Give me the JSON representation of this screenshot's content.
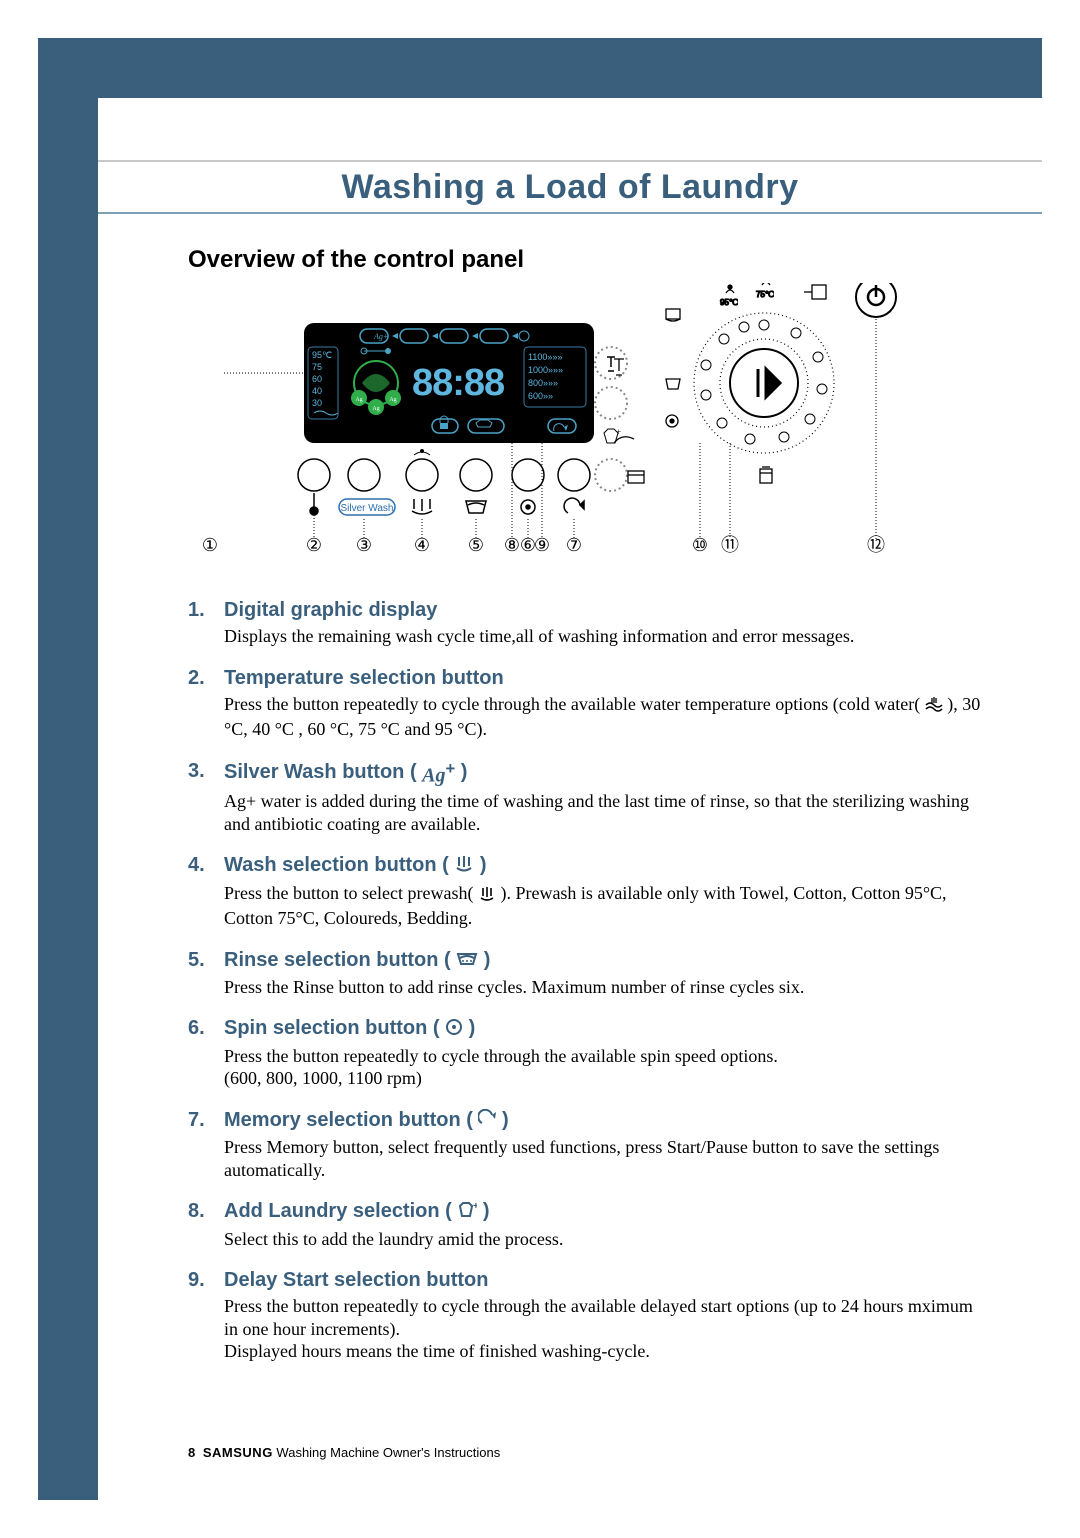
{
  "page": {
    "title": "Washing a Load of Laundry",
    "section": "Overview of the control panel",
    "footer": {
      "page_num": "8",
      "brand": "SAMSUNG",
      "tail": " Washing Machine Owner's Instructions"
    }
  },
  "diagram": {
    "display": {
      "temps": [
        "95℃",
        "75",
        "60",
        "40",
        "30"
      ],
      "spins": [
        "1100»»»",
        "1000»»»",
        "800»»»",
        "600»»"
      ],
      "digits": "88:88"
    },
    "buttons_row_label": "Silver Wash",
    "callouts": [
      "①",
      "②",
      "③",
      "④",
      "⑤",
      "⑥",
      "⑦",
      "⑧",
      "⑨",
      "⑩",
      "⑪",
      "⑫"
    ],
    "dial_top_labels": [
      "95℃",
      "75℃"
    ]
  },
  "items": [
    {
      "num": "1.",
      "title": "Digital graphic display",
      "icon": null,
      "desc": "Displays the remaining wash cycle time,all of washing information and error messages."
    },
    {
      "num": "2.",
      "title": "Temperature selection button",
      "icon": null,
      "desc_pre": "Press the button  repeatedly to cycle through the available water temperature options (cold water( ",
      "desc_post": " ), 30 °C, 40 °C , 60 °C, 75 °C and 95 °C).",
      "inline_icon": "cold-water-icon"
    },
    {
      "num": "3.",
      "title": "Silver Wash button ( ",
      "title_close": " )",
      "icon": "ag-plus-icon",
      "desc": "Ag+ water is added during the time of washing and the last time of rinse, so that the sterilizing washing and antibiotic coating are available."
    },
    {
      "num": "4.",
      "title": "Wash selection button ( ",
      "title_close": " )",
      "icon": "prewash-icon",
      "desc_pre": "Press the button to select prewash( ",
      "desc_post": " ). Prewash is available only with Towel, Cotton, Cotton 95°C, Cotton 75°C, Coloureds, Bedding.",
      "inline_icon": "prewash-inline-icon"
    },
    {
      "num": "5.",
      "title": "Rinse selection button ( ",
      "title_close": " )",
      "icon": "rinse-icon",
      "desc": "Press the Rinse button to add rinse cycles. Maximum number of rinse cycles six."
    },
    {
      "num": "6.",
      "title": "Spin selection button ( ",
      "title_close": " )",
      "icon": "spin-icon",
      "desc": "Press the button repeatedly to cycle through the available spin speed options.\n(600, 800, 1000, 1100 rpm)"
    },
    {
      "num": "7.",
      "title": "Memory selection button ( ",
      "title_close": " )",
      "icon": "memory-icon",
      "desc": "Press Memory button, select frequently used functions, press Start/Pause button to save the settings automatically."
    },
    {
      "num": "8.",
      "title": "Add Laundry selection ( ",
      "title_close": " )",
      "icon": "add-laundry-icon",
      "desc": "Select this to add the laundry amid the process."
    },
    {
      "num": "9.",
      "title": "Delay Start selection button",
      "icon": null,
      "desc": "Press the button repeatedly to cycle through the available delayed start options (up to 24 hours mximum in one hour increments).\nDisplayed hours means the time of finished washing-cycle."
    }
  ]
}
